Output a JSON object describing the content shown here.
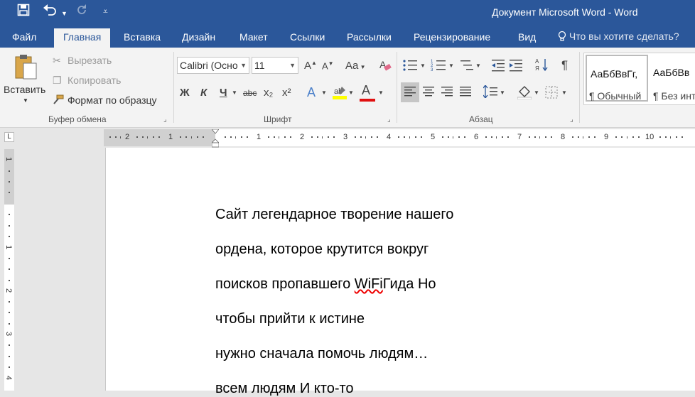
{
  "app": {
    "title": "Документ Microsoft Word  -  Word"
  },
  "quick_access": {
    "save_icon": "save-icon",
    "undo_icon": "undo-icon",
    "redo_icon": "redo-icon",
    "customize_icon": "customize-qat-icon"
  },
  "tabs": [
    {
      "label": "Файл"
    },
    {
      "label": "Главная"
    },
    {
      "label": "Вставка"
    },
    {
      "label": "Дизайн"
    },
    {
      "label": "Макет"
    },
    {
      "label": "Ссылки"
    },
    {
      "label": "Рассылки"
    },
    {
      "label": "Рецензирование"
    },
    {
      "label": "Вид"
    }
  ],
  "tellme": {
    "label": "Что вы хотите сделать?"
  },
  "ribbon": {
    "clipboard": {
      "group_label": "Буфер обмена",
      "paste": "Вставить",
      "cut": "Вырезать",
      "copy": "Копировать",
      "format_painter": "Формат по образцу"
    },
    "font": {
      "group_label": "Шрифт",
      "font_name": "Calibri (Осно",
      "font_size": "11",
      "bold": "Ж",
      "italic": "К",
      "underline": "Ч",
      "strike": "abc",
      "subscript": "x₂",
      "superscript": "x²",
      "change_case": "Aa",
      "text_effects": "A",
      "font_color": "A",
      "highlight_color": "#ffff00",
      "font_color_value": "#e01010"
    },
    "paragraph": {
      "group_label": "Абзац",
      "show_marks": "¶"
    },
    "styles": {
      "items": [
        {
          "sample": "АаБбВвГг,",
          "name": "¶ Обычный"
        },
        {
          "sample": "АаБбВв",
          "name": "¶ Без инт"
        }
      ]
    }
  },
  "ruler": {
    "tab_selector": "L",
    "h_numbers": [
      "2",
      "1",
      "1",
      "2",
      "3",
      "4",
      "5",
      "6",
      "7",
      "8",
      "9",
      "10"
    ],
    "v_numbers": [
      "1",
      "1",
      "2",
      "3",
      "4"
    ]
  },
  "document": {
    "lines": [
      {
        "text": "Сайт легендарное творение нашего"
      },
      {
        "text": "ордена, которое крутится вокруг"
      },
      {
        "before": "поисков пропавшего ",
        "misspelled": "WiFi",
        "after": "Гида Но"
      },
      {
        "text": "чтобы прийти к истине"
      },
      {
        "text": "нужно сначала помочь людям…"
      },
      {
        "text": "всем людям И кто-то"
      }
    ]
  }
}
